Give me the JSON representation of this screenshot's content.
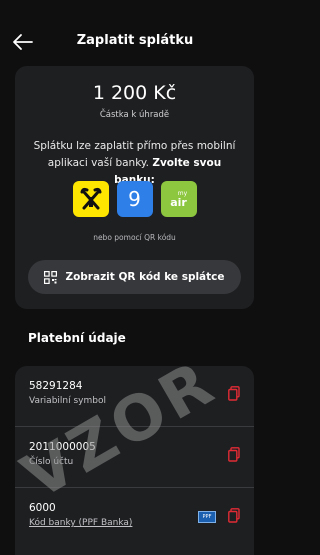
{
  "header": {
    "title": "Zaplatit splátku"
  },
  "payment": {
    "amount": "1 200 Kč",
    "amount_label": "Částka k úhradě",
    "info_text": "Splátku lze zaplatit přímo přes mobilní aplikaci vaší banky.",
    "info_emphasis": "Zvolte svou banku:",
    "banks": [
      {
        "name": "Raiffeisenbank",
        "icon": "raiffeisen-logo"
      },
      {
        "name": "George",
        "icon": "george-logo",
        "symbol": "9"
      },
      {
        "name": "Air Bank",
        "icon": "airbank-logo",
        "small": "my",
        "big": "air"
      }
    ],
    "qr_hint": "nebo pomocí QR kódu",
    "qr_button_label": "Zobrazit QR kód ke splátce"
  },
  "details_title": "Platební údaje",
  "details": [
    {
      "value": "58291284",
      "label": "Variabilní symbol"
    },
    {
      "value": "2011000005",
      "label": "Číslo účtu"
    },
    {
      "value": "6000",
      "label": "Kód banky (PPF Banka)",
      "badge": "PPF"
    }
  ],
  "watermark": "VZOR",
  "colors": {
    "accent_red": "#e02b35",
    "background": "#0f0f10",
    "card": "#1e1f21"
  }
}
